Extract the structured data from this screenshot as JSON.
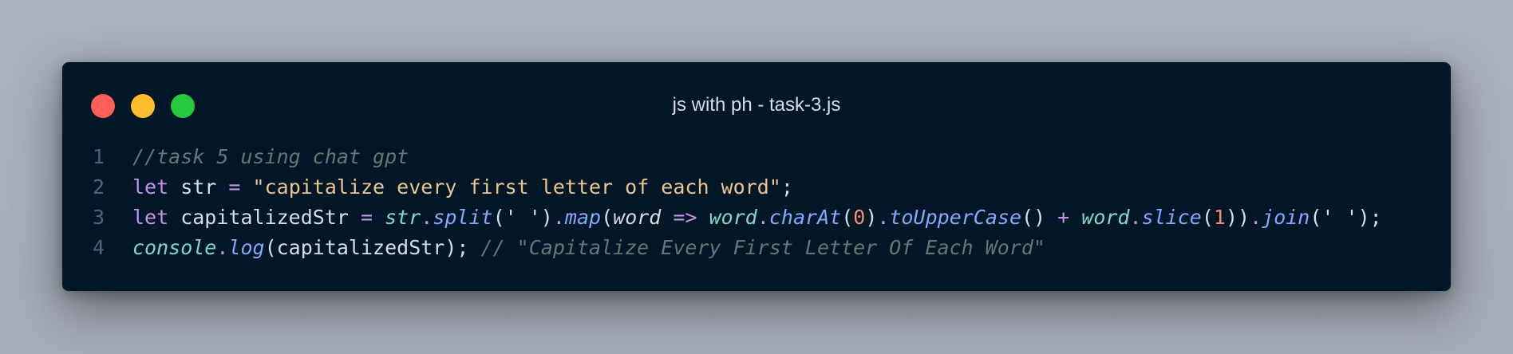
{
  "window": {
    "title": "js with ph - task-3.js",
    "controls": {
      "close_color": "#ff5f56",
      "minimize_color": "#ffbd2e",
      "maximize_color": "#27c93f"
    }
  },
  "theme": {
    "background": "#011627",
    "comment": "#637777",
    "keyword": "#c792ea",
    "string": "#ecc48d",
    "object": "#7fdbca",
    "method": "#82aaff",
    "number": "#f78c6c",
    "text": "#d6deeb"
  },
  "code": {
    "lines": [
      {
        "number": "1",
        "tokens": [
          {
            "t": "//task 5 using chat gpt",
            "k": "comment"
          }
        ]
      },
      {
        "number": "2",
        "tokens": [
          {
            "t": "let",
            "k": "keyword"
          },
          {
            "t": " str ",
            "k": "ident"
          },
          {
            "t": "=",
            "k": "op"
          },
          {
            "t": " ",
            "k": "punct"
          },
          {
            "t": "\"capitalize every first letter of each word\"",
            "k": "string"
          },
          {
            "t": ";",
            "k": "punct"
          }
        ]
      },
      {
        "number": "3",
        "tokens": [
          {
            "t": "let",
            "k": "keyword"
          },
          {
            "t": " capitalizedStr ",
            "k": "ident"
          },
          {
            "t": "=",
            "k": "op"
          },
          {
            "t": " ",
            "k": "punct"
          },
          {
            "t": "str",
            "k": "obj"
          },
          {
            "t": ".",
            "k": "op"
          },
          {
            "t": "split",
            "k": "method"
          },
          {
            "t": "(' ')",
            "k": "punct"
          },
          {
            "t": ".",
            "k": "op"
          },
          {
            "t": "map",
            "k": "method"
          },
          {
            "t": "(",
            "k": "punct"
          },
          {
            "t": "word",
            "k": "param"
          },
          {
            "t": " ",
            "k": "punct"
          },
          {
            "t": "=>",
            "k": "op"
          },
          {
            "t": " ",
            "k": "punct"
          },
          {
            "t": "word",
            "k": "obj"
          },
          {
            "t": ".",
            "k": "op"
          },
          {
            "t": "charAt",
            "k": "method"
          },
          {
            "t": "(",
            "k": "punct"
          },
          {
            "t": "0",
            "k": "number"
          },
          {
            "t": ")",
            "k": "punct"
          },
          {
            "t": ".",
            "k": "op"
          },
          {
            "t": "toUpperCase",
            "k": "method"
          },
          {
            "t": "() ",
            "k": "punct"
          },
          {
            "t": "+",
            "k": "op"
          },
          {
            "t": " ",
            "k": "punct"
          },
          {
            "t": "word",
            "k": "obj"
          },
          {
            "t": ".",
            "k": "op"
          },
          {
            "t": "slice",
            "k": "method"
          },
          {
            "t": "(",
            "k": "punct"
          },
          {
            "t": "1",
            "k": "number"
          },
          {
            "t": "))",
            "k": "punct"
          },
          {
            "t": ".",
            "k": "op"
          },
          {
            "t": "join",
            "k": "method"
          },
          {
            "t": "(' ');",
            "k": "punct"
          }
        ]
      },
      {
        "number": "4",
        "tokens": [
          {
            "t": "console",
            "k": "obj"
          },
          {
            "t": ".",
            "k": "op"
          },
          {
            "t": "log",
            "k": "method"
          },
          {
            "t": "(capitalizedStr); ",
            "k": "punct"
          },
          {
            "t": "// \"Capitalize Every First Letter Of Each Word\"",
            "k": "comment"
          }
        ]
      }
    ]
  }
}
